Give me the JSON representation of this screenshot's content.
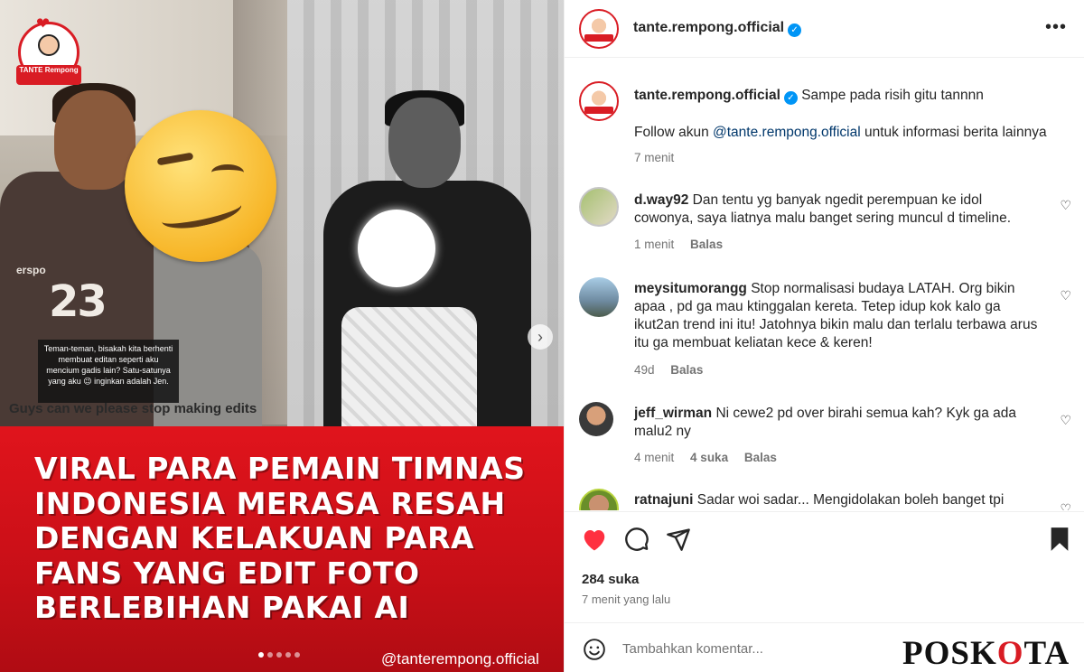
{
  "post_image": {
    "logo_text": "TANTE Rempong",
    "jersey_number": "23",
    "jersey_brand": "erspo",
    "caption_box": "Teman-teman, bisakah kita berhenti membuat editan seperti aku mencium gadis lain? Satu-satunya yang aku 😉 inginkan adalah Jen.",
    "caption_english": "Guys can we please stop making edits",
    "headline_lines": [
      "VIRAL PARA PEMAIN TIMNAS",
      "INDONESIA MERASA RESAH",
      "DENGAN KELAKUAN PARA",
      "FANS YANG EDIT FOTO",
      "BERLEBIHAN PAKAI AI"
    ],
    "watermark": "@tanterempong.official",
    "carousel_count": 5,
    "carousel_active": 0,
    "next_arrow": "›",
    "headline_bg": "#d6121b"
  },
  "header": {
    "username": "tante.rempong.official",
    "verified_glyph": "✓",
    "more": "•••"
  },
  "caption": {
    "username": "tante.rempong.official",
    "text": "Sampe pada risih gitu tannnn",
    "follow_prefix": "Follow akun ",
    "follow_link": "@tante.rempong.official",
    "follow_suffix": " untuk informasi berita lainnya",
    "time": "7 menit"
  },
  "comments": [
    {
      "username": "d.way92",
      "text": "Dan tentu yg banyak ngedit perempuan ke idol cowonya, saya liatnya malu banget sering muncul d timeline.",
      "time": "1 menit",
      "likes": "",
      "reply": "Balas"
    },
    {
      "username": "meysitumorangg",
      "text": "Stop normalisasi budaya LATAH. Org bikin apaa , pd ga mau ktinggalan kereta. Tetep idup kok kalo ga ikut2an trend ini itu! Jatohnya bikin malu dan terlalu terbawa arus itu ga membuat keliatan kece & keren!",
      "time": "49d",
      "likes": "",
      "reply": "Balas"
    },
    {
      "username": "jeff_wirman",
      "text": "Ni cewe2 pd over birahi semua kah? Kyk ga ada malu2 ny",
      "time": "4 menit",
      "likes": "4 suka",
      "reply": "Balas"
    },
    {
      "username": "ratnajuni",
      "text": "Sadar woi sadar... Mengidolakan boleh banget tpi",
      "time": "",
      "likes": "",
      "reply": ""
    }
  ],
  "actions": {
    "likes": "284 suka",
    "time_ago": "7 menit yang lalu",
    "like_color": "#ff3040"
  },
  "add_comment": {
    "placeholder": "Tambahkan komentar..."
  },
  "watermark_brand": {
    "text_a": "POSK",
    "text_o": "O",
    "text_b": "TA"
  }
}
